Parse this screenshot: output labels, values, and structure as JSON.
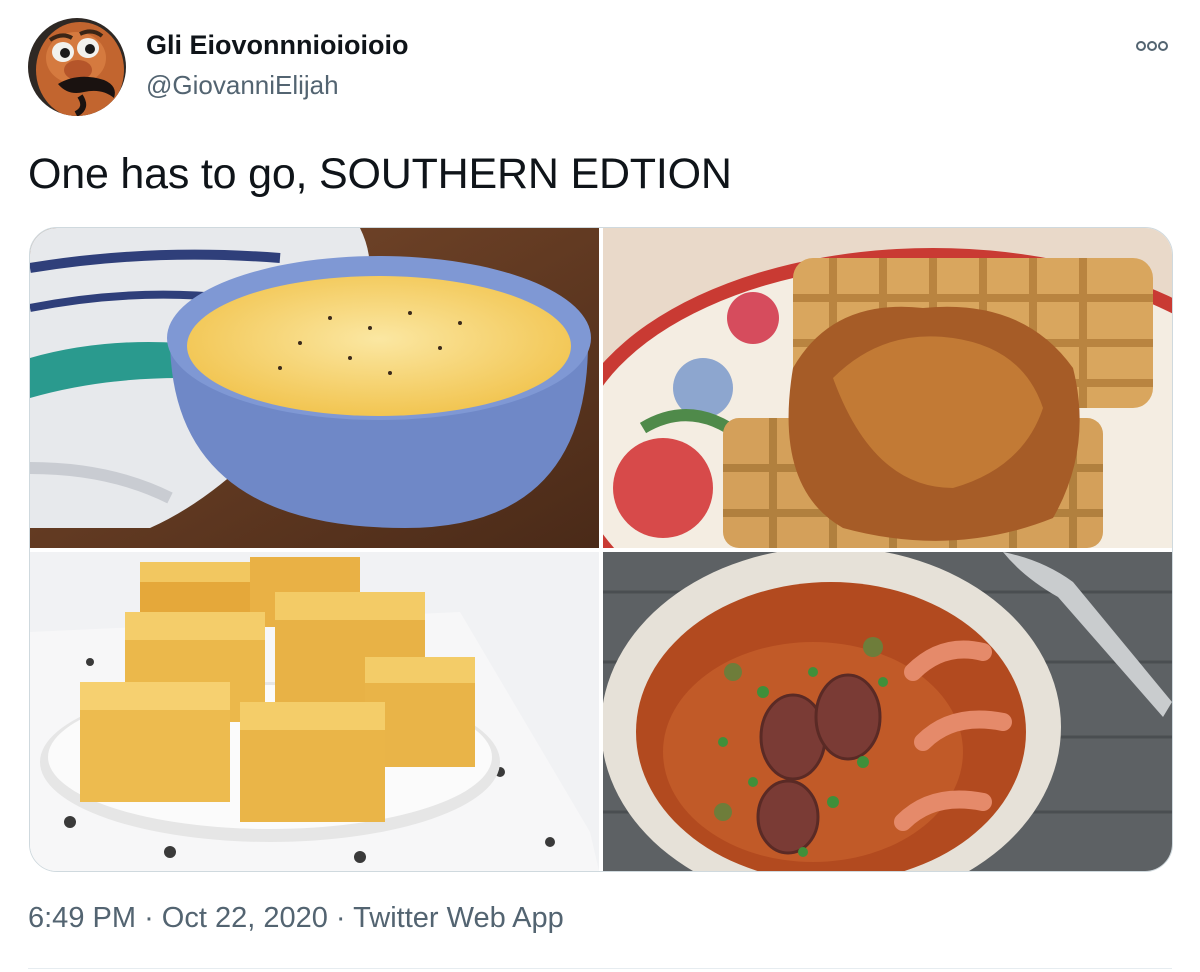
{
  "author": {
    "display_name": "Gli Eiovonnnioioioio",
    "handle": "@GiovanniElijah",
    "avatar_icon": "cartoon-character-avatar"
  },
  "more_icon": "more-options-icon",
  "tweet": {
    "text": "One has to go, SOUTHERN EDTION"
  },
  "media": [
    {
      "subject": "bowl-of-cheese-grits"
    },
    {
      "subject": "chicken-and-waffles"
    },
    {
      "subject": "cornbread-squares"
    },
    {
      "subject": "gumbo-with-sausage-and-shrimp"
    }
  ],
  "meta": {
    "time": "6:49 PM",
    "sep1": "·",
    "date": "Oct 22, 2020",
    "sep2": "·",
    "source": "Twitter Web App"
  },
  "colors": {
    "text": "#0f1419",
    "secondary": "#536471",
    "border": "#cfd9de"
  }
}
